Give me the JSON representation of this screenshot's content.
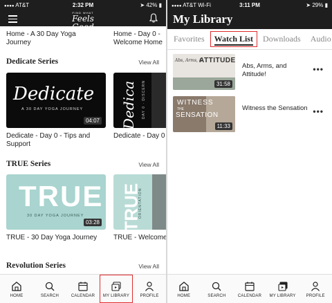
{
  "left": {
    "status": {
      "carrier": "AT&T",
      "time": "2:32 PM",
      "battery": "42%"
    },
    "logo": {
      "small": "FIND WHAT",
      "main": "Feels Good"
    },
    "top_items": [
      "Home - A 30 Day Yoga Journey",
      "Home - Day 0 - Welcome Home"
    ],
    "sections": [
      {
        "title": "Dedicate Series",
        "view_all": "View All",
        "cards": [
          {
            "title": "Dedicate - Day 0 - Tips and Support",
            "thumb_main": "Dedicate",
            "thumb_sub": "A 30 DAY YOGA JOURNEY",
            "duration": "04:07"
          },
          {
            "title": "Dedicate - Day 0",
            "thumb_main": "Dedica",
            "thumb_sub": "DAY 0 · DISCERN"
          }
        ]
      },
      {
        "title": "TRUE Series",
        "view_all": "View All",
        "cards": [
          {
            "title": "TRUE - 30 Day Yoga Journey",
            "thumb_main": "TRUE",
            "thumb_sub": "30 DAY YOGA JOURNEY",
            "duration": "03:28"
          },
          {
            "title": "TRUE - Welcome",
            "thumb_main": "TRUE",
            "thumb_sub": "ORIENTATION"
          }
        ]
      },
      {
        "title": "Revolution Series",
        "view_all": "View All"
      }
    ],
    "tabs": [
      {
        "label": "HOME",
        "icon": "home-icon"
      },
      {
        "label": "SEARCH",
        "icon": "search-icon"
      },
      {
        "label": "CALENDAR",
        "icon": "calendar-icon"
      },
      {
        "label": "MY LIBRARY",
        "icon": "library-icon"
      },
      {
        "label": "PROFILE",
        "icon": "profile-icon"
      }
    ]
  },
  "right": {
    "status": {
      "carrier": "AT&T Wi-Fi",
      "time": "3:11 PM",
      "battery": "29%"
    },
    "title": "My Library",
    "subtabs": [
      "Favorites",
      "Watch List",
      "Downloads",
      "Audio"
    ],
    "active_subtab": "Watch List",
    "items": [
      {
        "title": "Abs, Arms, and Attitude!",
        "thumb_script": "Abs, Arms, &",
        "thumb_main": "ATTITUDE",
        "duration": "31:58"
      },
      {
        "title": "Witness the Sensation",
        "thumb_main": "WITNESS",
        "thumb_main2": "SENSATION",
        "thumb_sub": "THE",
        "duration": "11:33"
      }
    ],
    "tabs": [
      {
        "label": "HOME",
        "icon": "home-icon"
      },
      {
        "label": "SEARCH",
        "icon": "search-icon"
      },
      {
        "label": "CALENDAR",
        "icon": "calendar-icon"
      },
      {
        "label": "MY LIBRARY",
        "icon": "library-icon"
      },
      {
        "label": "PROFILE",
        "icon": "profile-icon"
      }
    ]
  },
  "colors": {
    "header": "#1e1e1e",
    "highlight": "#e02b2b",
    "true_thumb": "#a9d4cf"
  }
}
